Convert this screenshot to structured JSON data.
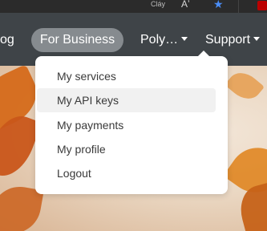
{
  "browser": {
    "small_text": "Cláy",
    "aa_label": "Aʼ"
  },
  "nav": {
    "blog_label": "og",
    "business_label": "For Business",
    "poly_label": "Poly…",
    "support_label": "Support"
  },
  "dropdown": {
    "items": [
      {
        "label": "My services"
      },
      {
        "label": "My API keys"
      },
      {
        "label": "My payments"
      },
      {
        "label": "My profile"
      },
      {
        "label": "Logout"
      }
    ]
  },
  "colors": {
    "navbar": "#3f4448",
    "pill": "#868b8f",
    "star": "#4a8df6"
  }
}
